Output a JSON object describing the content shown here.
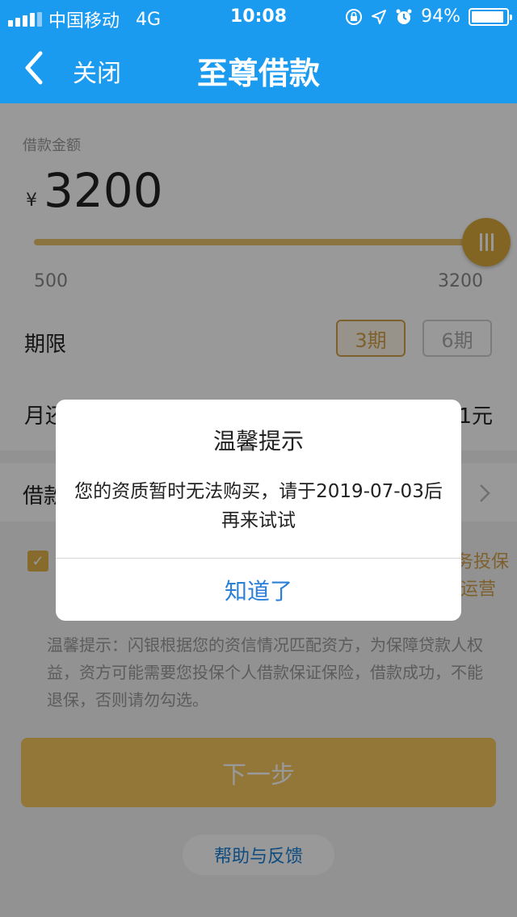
{
  "status_bar": {
    "carrier": "中国移动",
    "network": "4G",
    "time": "10:08",
    "battery": "94%",
    "battery_level": 0.94
  },
  "nav": {
    "close_label": "关闭",
    "title": "至尊借款"
  },
  "loan": {
    "amount_label": "借款金额",
    "currency": "¥",
    "amount": "3200",
    "slider_min": "500",
    "slider_max": "3200",
    "slider_value": 3200
  },
  "term": {
    "label": "期限",
    "options": [
      "3期",
      "6期"
    ],
    "selected": "3期"
  },
  "monthly": {
    "label_visible": "月还",
    "suffix_visible": "1元"
  },
  "loan_row": {
    "label_visible": "借款"
  },
  "agreement": {
    "checked": true,
    "tail_line1": "务投保",
    "tail_line2": "运营"
  },
  "hint": "温馨提示：闪银根据您的资信情况匹配资方，为保障贷款人权益，资方可能需要您投保个人借款保证保险，借款成功，不能退保，否则请勿勾选。",
  "next_button": "下一步",
  "help_button": "帮助与反馈",
  "dialog": {
    "title": "温馨提示",
    "message": "您的资质暂时无法购买，请于2019-07-03后再来试试",
    "confirm": "知道了"
  },
  "colors": {
    "brand_blue": "#1a9bf0",
    "gold": "#d9a93a",
    "link_blue": "#2a7fd8"
  }
}
